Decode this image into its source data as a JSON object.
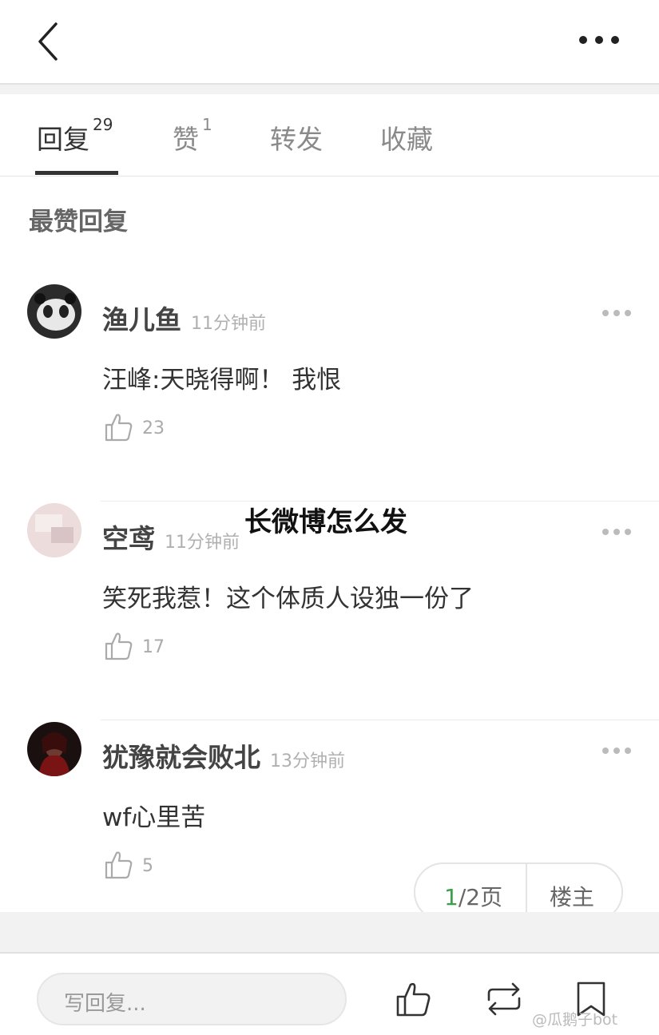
{
  "tabs": [
    {
      "label": "回复",
      "count": "29"
    },
    {
      "label": "赞",
      "count": "1"
    },
    {
      "label": "转发",
      "count": ""
    },
    {
      "label": "收藏",
      "count": ""
    }
  ],
  "section_title": "最赞回复",
  "comments": [
    {
      "user": "渔儿鱼",
      "time": "11分钟前",
      "text": "汪峰:天晓得啊！ 我恨",
      "likes": "23"
    },
    {
      "user": "空鸢",
      "time": "11分钟前",
      "text": "笑死我惹！这个体质人设独一份了",
      "likes": "17"
    },
    {
      "user": "犹豫就会败北",
      "time": "13分钟前",
      "text": "wf心里苦",
      "likes": "5"
    }
  ],
  "overlay_title": "长微博怎么发",
  "pager": {
    "current": "1",
    "rest": "/2页",
    "owner_label": "楼主"
  },
  "reply_placeholder": "写回复...",
  "watermark": "@瓜鹅子bot",
  "colors": {
    "accent_green": "#3aa14a",
    "text_dark": "#333333",
    "text_gray": "#8a8a8a"
  }
}
